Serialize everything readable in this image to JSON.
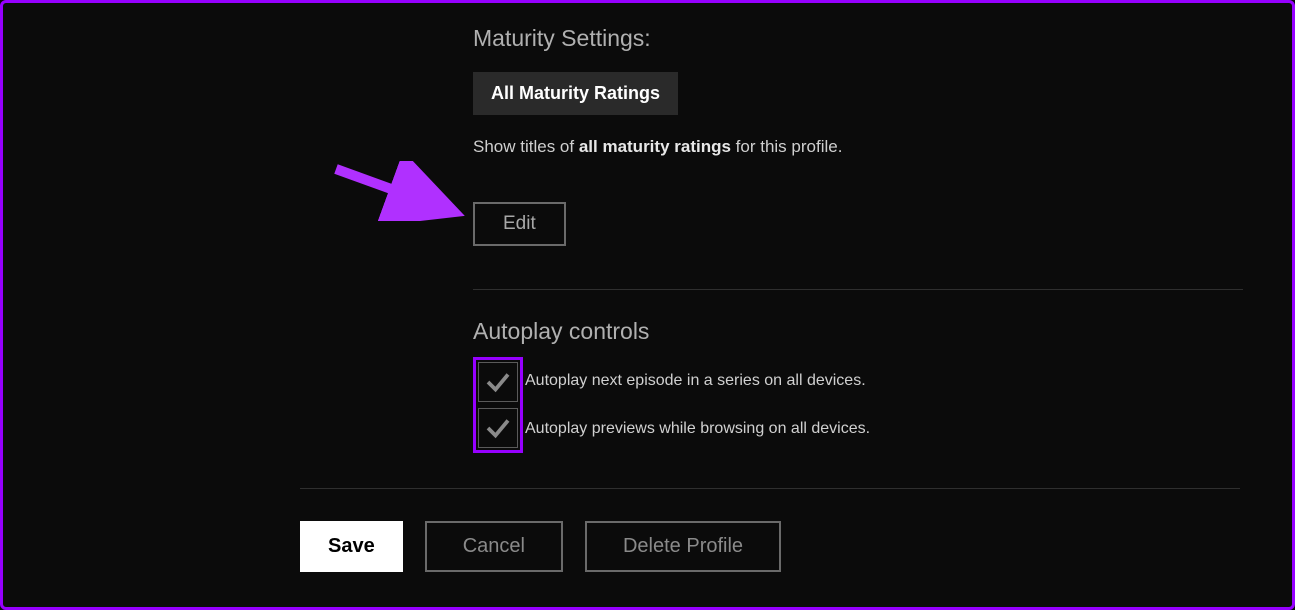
{
  "maturity": {
    "title": "Maturity Settings:",
    "badge": "All Maturity Ratings",
    "description_prefix": "Show titles of ",
    "description_bold": "all maturity ratings",
    "description_suffix": " for this profile.",
    "edit_label": "Edit"
  },
  "autoplay": {
    "title": "Autoplay controls",
    "items": [
      "Autoplay next episode in a series on all devices.",
      "Autoplay previews while browsing on all devices."
    ]
  },
  "footer": {
    "save_label": "Save",
    "cancel_label": "Cancel",
    "delete_label": "Delete Profile"
  },
  "colors": {
    "accent": "#9600ff",
    "background": "#0b0b0b"
  }
}
